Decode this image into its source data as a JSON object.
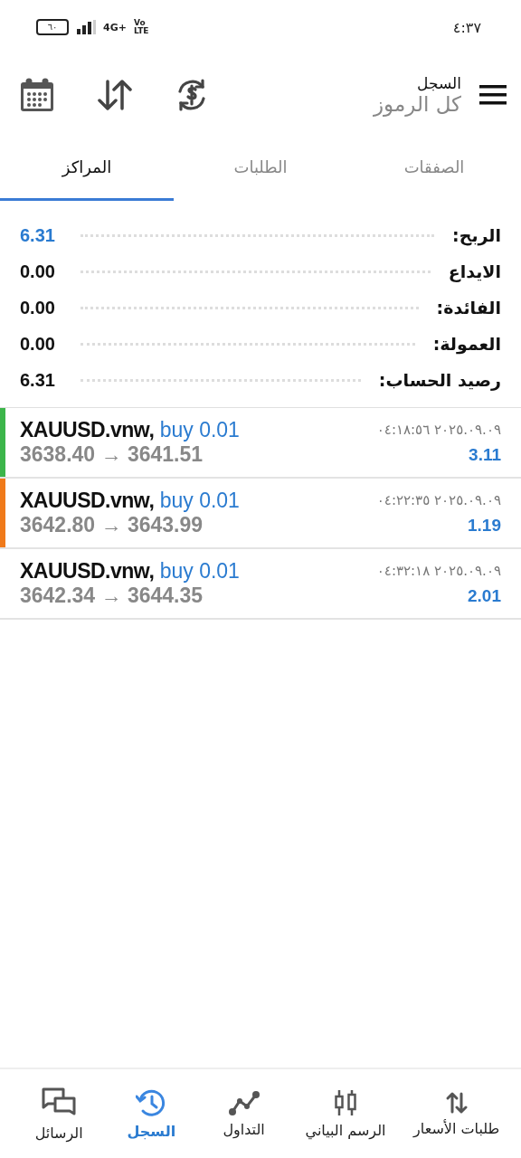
{
  "status_bar": {
    "time": "٤:٣٧",
    "battery": "٦٠",
    "network": "4G+",
    "volte_top": "Vo",
    "volte_bottom": "LTE"
  },
  "header": {
    "title": "السجل",
    "subtitle": "كل الرموز"
  },
  "tabs": [
    {
      "label": "الصفقات",
      "selected": false
    },
    {
      "label": "الطلبات",
      "selected": false
    },
    {
      "label": "المراكز",
      "selected": true
    }
  ],
  "summary": [
    {
      "label": "الربح:",
      "value": "6.31",
      "highlight": true
    },
    {
      "label": "الايداع",
      "value": "0.00",
      "highlight": false
    },
    {
      "label": "الفائدة:",
      "value": "0.00",
      "highlight": false
    },
    {
      "label": "العمولة:",
      "value": "0.00",
      "highlight": false
    },
    {
      "label": "رصيد الحساب:",
      "value": "6.31",
      "highlight": false
    }
  ],
  "positions": [
    {
      "symbol": "XAUUSD.vnw,",
      "order": "buy 0.01",
      "prices": "3638.40 → 3641.51",
      "time": "٢٠٢٥.٠٩.٠٩ ٠٤:١٨:٥٦",
      "profit": "3.11",
      "color": "#3cb54a"
    },
    {
      "symbol": "XAUUSD.vnw,",
      "order": "buy 0.01",
      "prices": "3642.80 → 3643.99",
      "time": "٢٠٢٥.٠٩.٠٩ ٠٤:٢٢:٣٥",
      "profit": "1.19",
      "color": "#f07a1a"
    },
    {
      "symbol": "XAUUSD.vnw,",
      "order": "buy 0.01",
      "prices": "3642.34 → 3644.35",
      "time": "٢٠٢٥.٠٩.٠٩ ٠٤:٣٢:١٨",
      "profit": "2.01"
    }
  ],
  "bottom_nav": [
    {
      "label": "طلبات الأسعار",
      "selected": false
    },
    {
      "label": "الرسم البياني",
      "selected": false
    },
    {
      "label": "التداول",
      "selected": false
    },
    {
      "label": "السجل",
      "selected": true
    },
    {
      "label": "الرسائل",
      "selected": false
    }
  ]
}
